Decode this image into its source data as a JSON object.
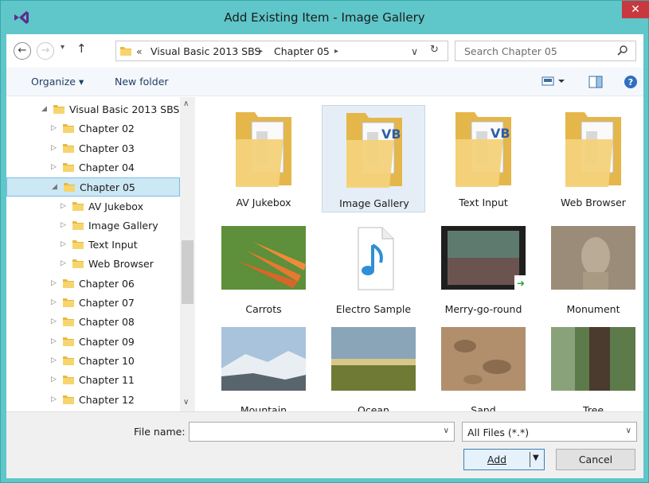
{
  "window": {
    "title": "Add Existing Item - Image Gallery",
    "close_glyph": "✕"
  },
  "nav": {
    "back_glyph": "←",
    "forward_glyph": "→",
    "recent_glyph": "▾",
    "up_glyph": "↑",
    "breadcrumb": [
      {
        "text": "«"
      },
      {
        "text": "Visual Basic 2013 SBS"
      },
      {
        "text": "▸"
      },
      {
        "text": "Chapter 05"
      },
      {
        "text": "▸"
      }
    ],
    "address_dropdown_glyph": "∨",
    "refresh_glyph": "↻",
    "search_placeholder": "Search Chapter 05"
  },
  "toolbar": {
    "organize_label": "Organize ▾",
    "new_folder_label": "New folder"
  },
  "tree": {
    "items": [
      {
        "label": "Visual Basic 2013 SBS",
        "expander": "◢",
        "indent": 0
      },
      {
        "label": "Chapter 02",
        "expander": "▷",
        "indent": 1
      },
      {
        "label": "Chapter 03",
        "expander": "▷",
        "indent": 1
      },
      {
        "label": "Chapter 04",
        "expander": "▷",
        "indent": 1
      },
      {
        "label": "Chapter 05",
        "expander": "◢",
        "indent": 1,
        "selected": true
      },
      {
        "label": "AV Jukebox",
        "expander": "▷",
        "indent": 2
      },
      {
        "label": "Image Gallery",
        "expander": "▷",
        "indent": 2
      },
      {
        "label": "Text Input",
        "expander": "▷",
        "indent": 2
      },
      {
        "label": "Web Browser",
        "expander": "▷",
        "indent": 2
      },
      {
        "label": "Chapter 06",
        "expander": "▷",
        "indent": 1
      },
      {
        "label": "Chapter 07",
        "expander": "▷",
        "indent": 1
      },
      {
        "label": "Chapter 08",
        "expander": "▷",
        "indent": 1
      },
      {
        "label": "Chapter 09",
        "expander": "▷",
        "indent": 1
      },
      {
        "label": "Chapter 10",
        "expander": "▷",
        "indent": 1
      },
      {
        "label": "Chapter 11",
        "expander": "▷",
        "indent": 1
      },
      {
        "label": "Chapter 12",
        "expander": "▷",
        "indent": 1
      }
    ],
    "scroll_up_glyph": "∧",
    "scroll_down_glyph": "∨"
  },
  "files": [
    {
      "name": "AV Jukebox",
      "kind": "folder-icon"
    },
    {
      "name": "Image Gallery",
      "kind": "folder-icon",
      "selected": true
    },
    {
      "name": "Text Input",
      "kind": "folder-icon"
    },
    {
      "name": "Web Browser",
      "kind": "folder-icon"
    },
    {
      "name": "Carrots",
      "kind": "carrots-thumbnail"
    },
    {
      "name": "Electro Sample",
      "kind": "audio-file-icon"
    },
    {
      "name": "Merry-go-round",
      "kind": "video-thumbnail"
    },
    {
      "name": "Monument",
      "kind": "monument-thumbnail"
    },
    {
      "name": "Mountain",
      "kind": "mountain-thumbnail"
    },
    {
      "name": "Ocean",
      "kind": "ocean-thumbnail"
    },
    {
      "name": "Sand",
      "kind": "sand-thumbnail"
    },
    {
      "name": "Tree",
      "kind": "tree-thumbnail"
    }
  ],
  "bottom": {
    "file_name_label": "File name:",
    "file_name_value": "",
    "filter_value": "All Files (*.*)",
    "add_label": "Add",
    "cancel_label": "Cancel",
    "dropdown_glyph": "∨"
  }
}
